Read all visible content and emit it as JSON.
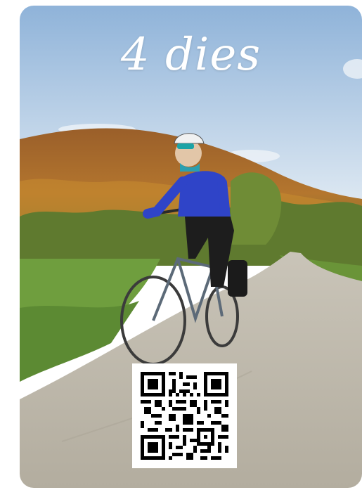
{
  "card": {
    "title": "4 dies"
  },
  "colors": {
    "sky_top": "#8fb3d9",
    "sky_bottom": "#dfe9f2",
    "hill": "#a2672c",
    "forest": "#5f7a2f",
    "grass": "#6f9e3e",
    "road": "#bdb7aa",
    "jersey": "#2f44c8"
  },
  "icons": {
    "qr": "qr-code-icon",
    "cyclist": "cyclist-photo"
  }
}
